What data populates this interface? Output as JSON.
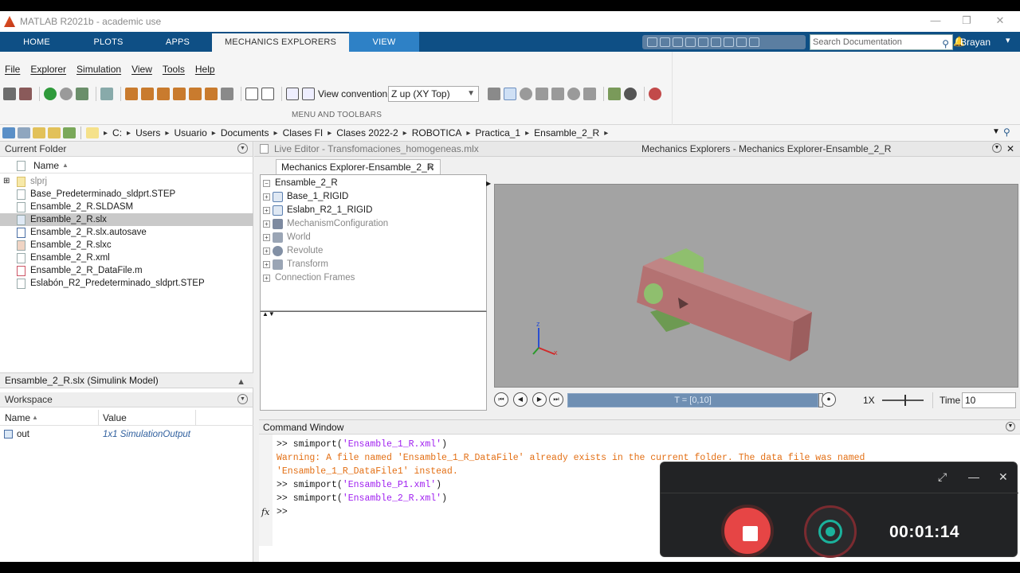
{
  "window": {
    "title": "MATLAB R2021b - academic use"
  },
  "ribbon_tabs": [
    "HOME",
    "PLOTS",
    "APPS",
    "MECHANICS EXPLORERS",
    "VIEW"
  ],
  "search": {
    "placeholder": "Search Documentation"
  },
  "user": {
    "name": "Brayan"
  },
  "menu": [
    "File",
    "Explorer",
    "Simulation",
    "View",
    "Tools",
    "Help"
  ],
  "toolbar": {
    "view_convention_label": "View convention:",
    "view_convention_value": "Z up (XY Top)",
    "section_label": "MENU AND TOOLBARS"
  },
  "address": {
    "crumbs": [
      "C:",
      "Users",
      "Usuario",
      "Documents",
      "Clases FI",
      "Clases 2022-2",
      "ROBOTICA",
      "Practica_1",
      "Ensamble_2_R"
    ]
  },
  "current_folder": {
    "title": "Current Folder",
    "column_name": "Name",
    "files": [
      "slprj",
      "Base_Predeterminado_sldprt.STEP",
      "Ensamble_2_R.SLDASM",
      "Ensamble_2_R.slx",
      "Ensamble_2_R.slx.autosave",
      "Ensamble_2_R.slxc",
      "Ensamble_2_R.xml",
      "Ensamble_2_R_DataFile.m",
      "Eslabón_R2_Predeterminado_sldprt.STEP"
    ],
    "selected_index": 3,
    "details": "Ensamble_2_R.slx  (Simulink Model)"
  },
  "workspace": {
    "title": "Workspace",
    "col_name": "Name",
    "col_value": "Value",
    "rows": [
      {
        "name": "out",
        "value": "1x1 SimulationOutput"
      }
    ]
  },
  "editor": {
    "live_editor_tab": "Live Editor - Transfomaciones_homogeneas.mlx",
    "mech_title": "Mechanics Explorers - Mechanics Explorer-Ensamble_2_R",
    "doc_tab": "Mechanics Explorer-Ensamble_2_R"
  },
  "tree": {
    "root": "Ensamble_2_R",
    "nodes": [
      "Base_1_RIGID",
      "Eslabn_R2_1_RIGID",
      "MechanismConfiguration",
      "World",
      "Revolute",
      "Transform",
      "Connection Frames"
    ]
  },
  "playback": {
    "timeline": "T = [0,10]",
    "speed": "1X",
    "time_label": "Time",
    "time_value": "10"
  },
  "axes": {
    "z": "z",
    "x": "x"
  },
  "command_window": {
    "title": "Command Window",
    "lines": [
      {
        "prompt": ">>",
        "cmd": "smimport(",
        "arg": "'Ensamble_1_R.xml'",
        "end": ")"
      },
      {
        "warning": "Warning: A file named 'Ensamble_1_R_DataFile' already exists in the current folder. The data file was named"
      },
      {
        "warning": "'Ensamble_1_R_DataFile1' instead."
      },
      {
        "prompt": ">>",
        "cmd": "smimport(",
        "arg": "'Ensamble_P1.xml'",
        "end": ")"
      },
      {
        "prompt": ">>",
        "cmd": "smimport(",
        "arg": "'Ensamble_2_R.xml'",
        "end": ")"
      }
    ],
    "current_prompt": ">>",
    "fx": "fx"
  },
  "recorder": {
    "time": "00:01:14"
  }
}
